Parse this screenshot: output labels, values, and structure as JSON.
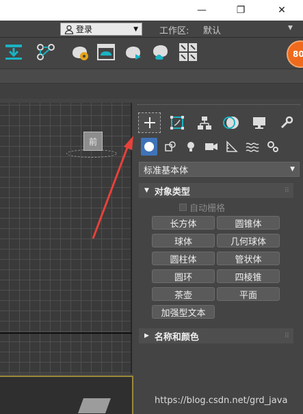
{
  "window": {
    "minimize": "—",
    "maximize": "❐",
    "close": "✕"
  },
  "login": {
    "label": "登录"
  },
  "workspace": {
    "label": "工作区:",
    "value": "默认"
  },
  "badge": {
    "value": "80"
  },
  "viewport": {
    "cube_label": "前"
  },
  "panel": {
    "dropdown": "标准基本体",
    "object_type": "对象类型",
    "auto_grid": "自动栅格",
    "buttons": [
      "长方体",
      "圆锥体",
      "球体",
      "几何球体",
      "圆柱体",
      "管状体",
      "圆环",
      "四棱锥",
      "茶壶",
      "平面",
      "加强型文本"
    ],
    "name_color": "名称和颜色"
  },
  "watermark": "https://blog.csdn.net/grd_java",
  "colors": {
    "accent": "#3f73b8",
    "annotation_arrow": "#e8413a",
    "badge": "#ef6a1c"
  }
}
